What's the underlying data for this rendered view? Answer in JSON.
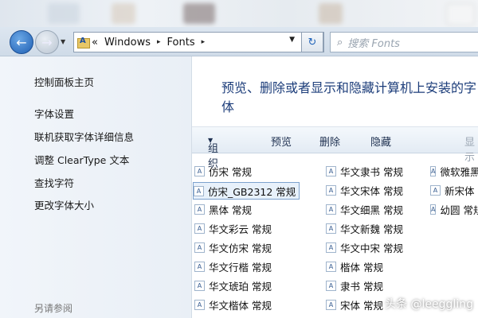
{
  "nav": {
    "back_icon": "←",
    "forward_icon": "→",
    "breadcrumb_prefix": "«",
    "path": [
      "Windows",
      "Fonts"
    ],
    "separator": "▸",
    "dropdown_icon": "▼",
    "refresh_icon": "↻",
    "search_placeholder": "搜索 Fonts"
  },
  "sidebar": {
    "items": [
      {
        "label": "控制面板主页"
      },
      {
        "label": "字体设置"
      },
      {
        "label": "联机获取字体详细信息"
      },
      {
        "label": "调整 ClearType 文本"
      },
      {
        "label": "查找字符"
      },
      {
        "label": "更改字体大小"
      }
    ],
    "see_also": "另请参阅"
  },
  "main": {
    "description": "预览、删除或者显示和隐藏计算机上安装的字体"
  },
  "toolbar": {
    "organize": "组织",
    "organize_arrow": "▼",
    "preview": "预览",
    "delete": "删除",
    "hide": "隐藏",
    "show": "显示"
  },
  "fonts": {
    "column1": [
      "仿宋 常规",
      "仿宋_GB2312 常规",
      "黑体 常规",
      "华文彩云 常规",
      "华文仿宋 常规",
      "华文行楷 常规",
      "华文琥珀 常规",
      "华文楷体 常规"
    ],
    "column2": [
      "华文隶书 常规",
      "华文宋体 常规",
      "华文细黑 常规",
      "华文新魏 常规",
      "华文中宋 常规",
      "楷体 常规",
      "隶书 常规",
      "宋体 常规"
    ],
    "column3": [
      "微软雅黑",
      "新宋体",
      "幼圆 常规"
    ],
    "icon_glyph": "A"
  },
  "watermark": "头条 @leeggling"
}
